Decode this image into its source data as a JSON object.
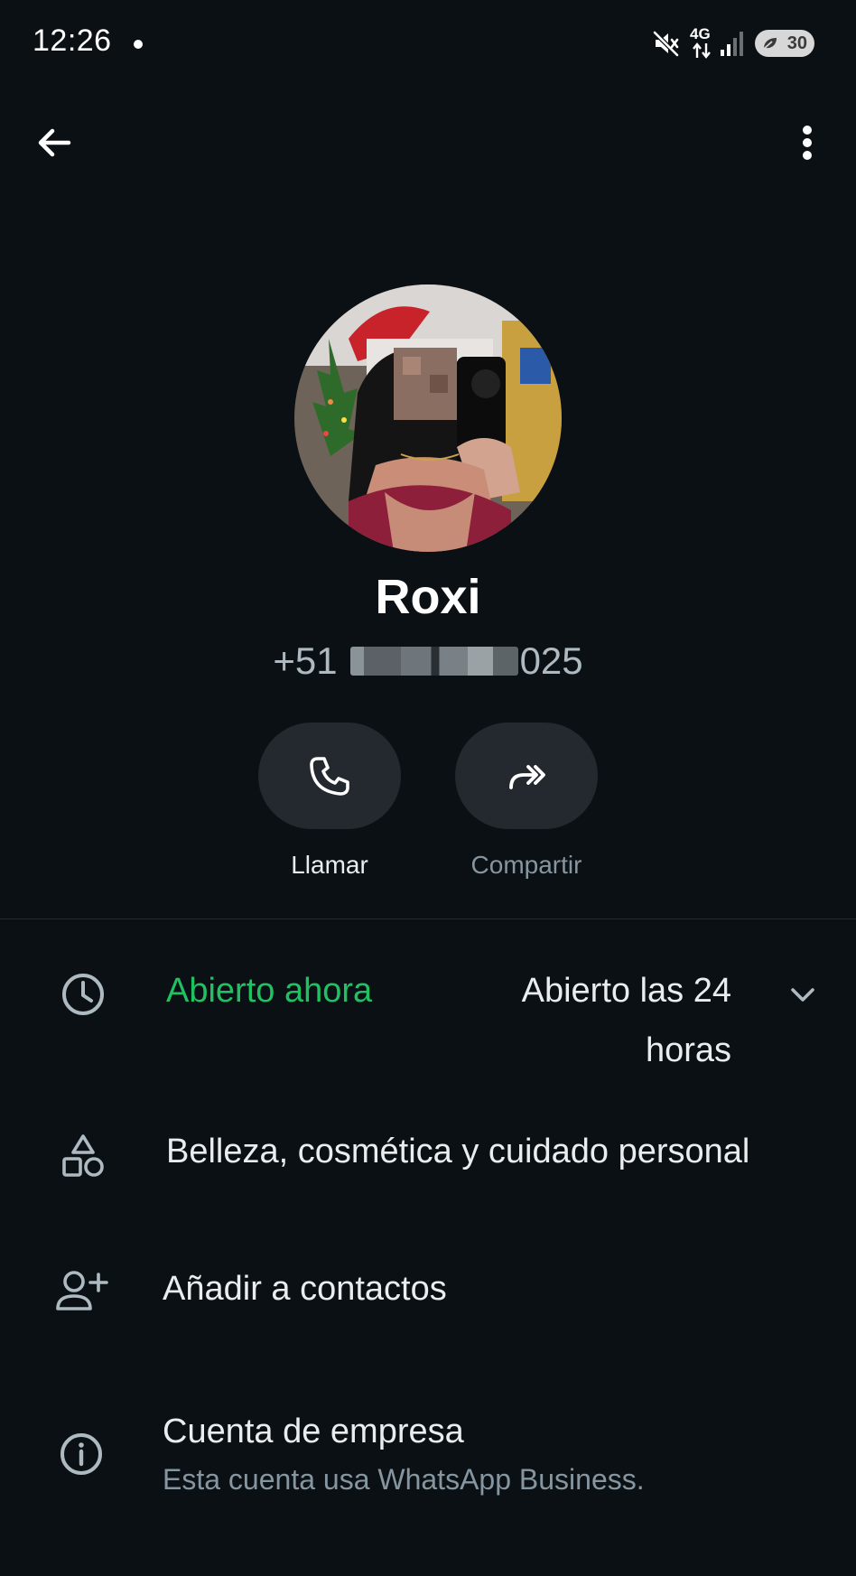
{
  "status_bar": {
    "time": "12:26",
    "network": "4G",
    "battery": "30"
  },
  "contact": {
    "name": "Roxi",
    "phone_prefix": "+51",
    "phone_suffix": "025"
  },
  "actions": [
    {
      "label": "Llamar",
      "icon": "phone-icon"
    },
    {
      "label": "Compartir",
      "icon": "share-icon"
    }
  ],
  "hours": {
    "status": "Abierto ahora",
    "schedule": "Abierto las 24 horas"
  },
  "category": "Belleza, cosmética y cuidado personal",
  "add_contact": "Añadir a contactos",
  "business": {
    "title": "Cuenta de empresa",
    "subtitle": "Esta cuenta usa WhatsApp Business."
  },
  "colors": {
    "background": "#0b1014",
    "accent_green": "#21c063",
    "button_bg": "#23292e",
    "secondary_text": "#8696a0"
  }
}
